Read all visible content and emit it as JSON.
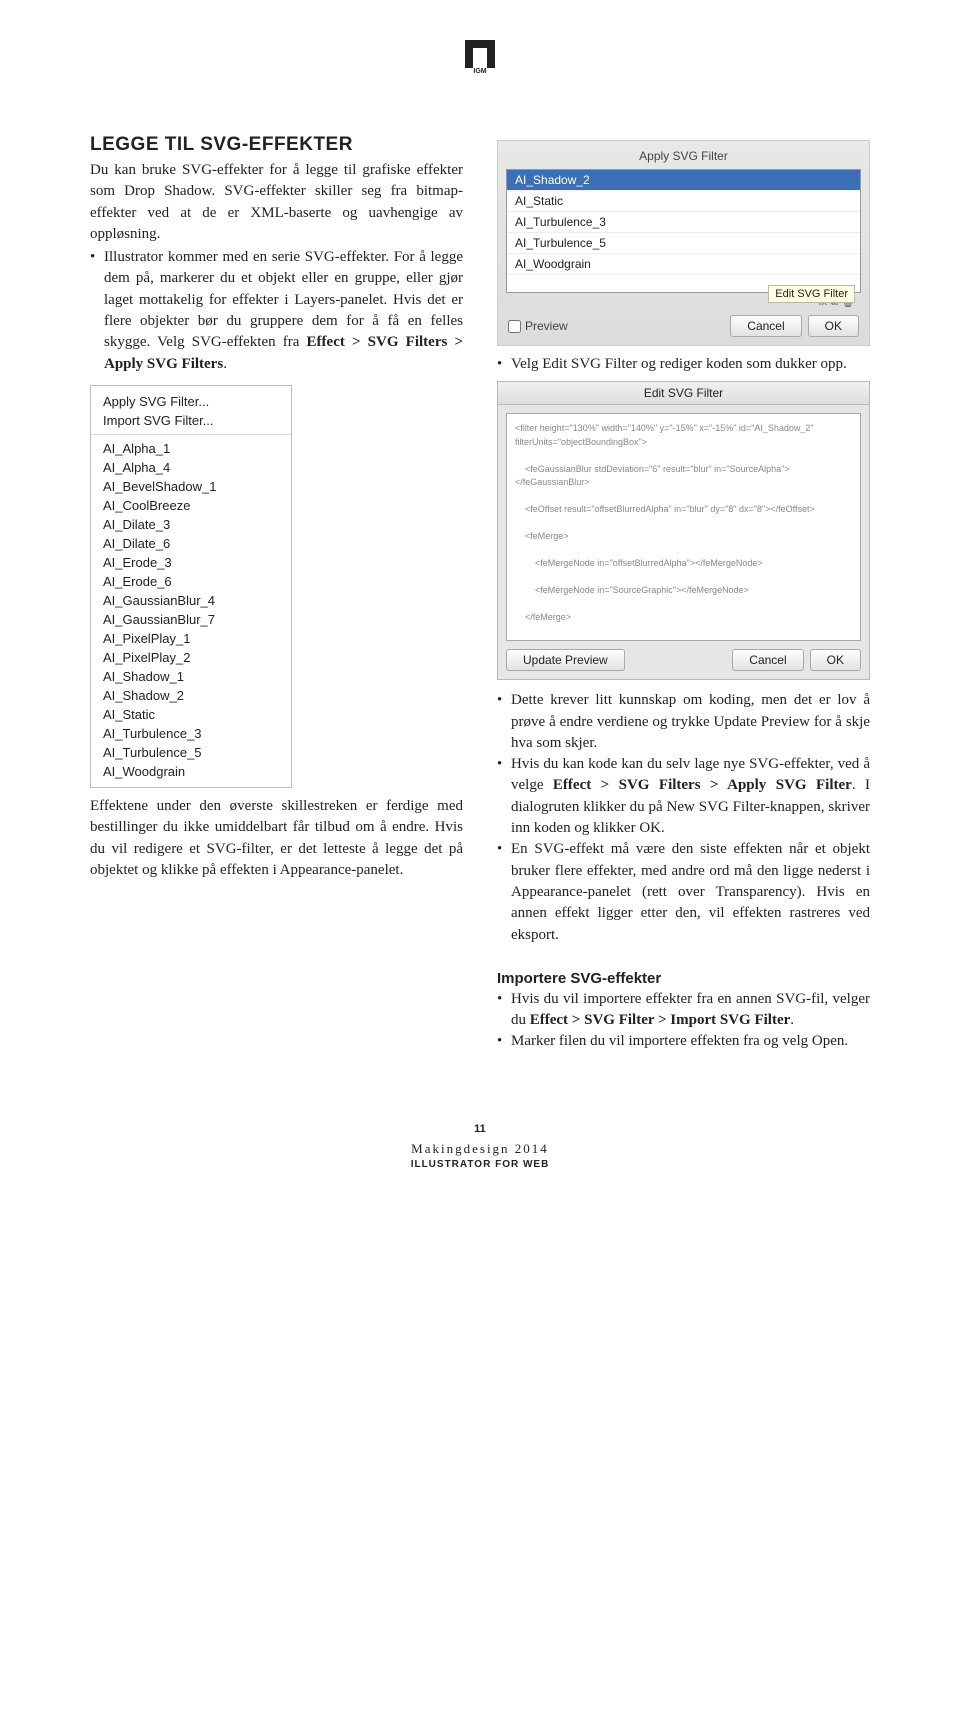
{
  "header": {
    "logo_text": "IGM"
  },
  "left": {
    "h1": "LEGGE TIL SVG-EFFEKTER",
    "p1a": "Du kan bruke SVG-effekter for å legge til grafiske effekter som Drop Shadow. SVG-effekter skiller seg fra bitmap-effekter ved at de er XML-baserte og uavhengige av oppløsning.",
    "b1a": "Illustrator kommer med en serie SVG-effekter. For å legge dem på, markerer du et objekt eller en gruppe, eller gjør laget mottakelig for effekter i Layers-panelet. Hvis det er flere objekter bør du gruppere dem for å få en felles skygge. Velg SVG-effekten fra ",
    "b1b": "Effect > SVG Filters > Apply SVG Filters",
    "b1c": ".",
    "menu": {
      "top": [
        "Apply SVG Filter...",
        "Import SVG Filter..."
      ],
      "items": [
        "AI_Alpha_1",
        "AI_Alpha_4",
        "AI_BevelShadow_1",
        "AI_CoolBreeze",
        "AI_Dilate_3",
        "AI_Dilate_6",
        "AI_Erode_3",
        "AI_Erode_6",
        "AI_GaussianBlur_4",
        "AI_GaussianBlur_7",
        "AI_PixelPlay_1",
        "AI_PixelPlay_2",
        "AI_Shadow_1",
        "AI_Shadow_2",
        "AI_Static",
        "AI_Turbulence_3",
        "AI_Turbulence_5",
        "AI_Woodgrain"
      ]
    },
    "p2": "Effektene under den øverste skillestreken er ferdige med bestillinger du ikke umiddelbart får tilbud om å endre. Hvis du vil redigere et SVG-filter, er det letteste å legge det på objektet og klikke på effekten i Appearance-panelet."
  },
  "right": {
    "dialog1": {
      "title": "Apply SVG Filter",
      "items": [
        "AI_Shadow_2",
        "AI_Static",
        "AI_Turbulence_3",
        "AI_Turbulence_5",
        "AI_Woodgrain"
      ],
      "iconbar": "fx  ⧉  🗑",
      "tooltip": "Edit SVG Filter",
      "preview": "Preview",
      "cancel": "Cancel",
      "ok": "OK"
    },
    "b1": "Velg Edit SVG Filter og rediger koden som dukker opp.",
    "dialog2": {
      "title": "Edit SVG Filter",
      "code": "<filter height=\"130%\" width=\"140%\" y=\"-15%\" x=\"-15%\" id=\"AI_Shadow_2\" filterUnits=\"objectBoundingBox\">\n\n    <feGaussianBlur stdDeviation=\"6\" result=\"blur\" in=\"SourceAlpha\"></feGaussianBlur>\n\n    <feOffset result=\"offsetBlurredAlpha\" in=\"blur\" dy=\"8\" dx=\"8\"></feOffset>\n\n    <feMerge>\n\n        <feMergeNode in=\"offsetBlurredAlpha\"></feMergeNode>\n\n        <feMergeNode in=\"SourceGraphic\"></feMergeNode>\n\n    </feMerge>\n\n</filter>",
      "update": "Update Preview",
      "cancel": "Cancel",
      "ok": "OK"
    },
    "b2": "Dette krever litt kunnskap om koding, men det er lov å prøve å endre verdiene og trykke Update Preview for å skje hva som skjer.",
    "b3a": "Hvis du kan kode kan du selv lage nye SVG-effekter, ved å velge ",
    "b3b": "Effect > SVG Filters > Apply SVG Filter",
    "b3c": ". I dialogruten klikker du på New SVG Filter-knappen, skriver inn koden og klikker OK.",
    "b4": "En SVG-effekt må være den siste effekten når et objekt bruker flere effekter, med andre ord må den ligge nederst i Appearance-panelet (rett over Transparency). Hvis en annen effekt ligger etter den, vil effekten rastreres ved eksport.",
    "h2": "Importere SVG-effekter",
    "b5a": "Hvis du vil importere effekter fra en annen SVG-fil, velger du ",
    "b5b": "Effect > SVG Filter > Import SVG Filter",
    "b5c": ".",
    "b6": "Marker filen du vil importere effekten fra og velg Open."
  },
  "footer": {
    "page": "11",
    "l1": "Makingdesign 2014",
    "l2": "ILLUSTRATOR FOR WEB"
  }
}
